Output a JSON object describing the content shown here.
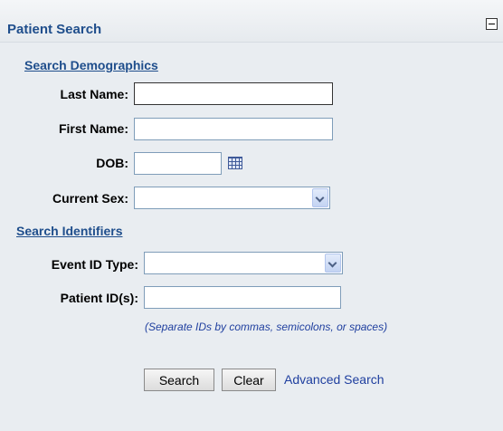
{
  "panel": {
    "title": "Patient Search"
  },
  "demographics": {
    "section_label": "Search Demographics",
    "last_name_label": "Last Name:",
    "last_name_value": "",
    "first_name_label": "First Name:",
    "first_name_value": "",
    "dob_label": "DOB:",
    "dob_value": "",
    "current_sex_label": "Current Sex:",
    "current_sex_value": ""
  },
  "identifiers": {
    "section_label": "Search Identifiers",
    "event_id_type_label": "Event ID Type:",
    "event_id_type_value": "",
    "patient_ids_label": "Patient ID(s):",
    "patient_ids_value": "",
    "patient_ids_hint": "(Separate IDs by commas, semicolons, or spaces)"
  },
  "actions": {
    "search_label": "Search",
    "clear_label": "Clear",
    "advanced_search_label": "Advanced Search"
  },
  "icons": {
    "collapse": "collapse-icon",
    "calendar": "calendar-icon",
    "dropdown": "chevron-down-icon"
  },
  "colors": {
    "title": "#1f4e8c",
    "link": "#1f3f9f",
    "panel_bg": "#e9edf1"
  }
}
